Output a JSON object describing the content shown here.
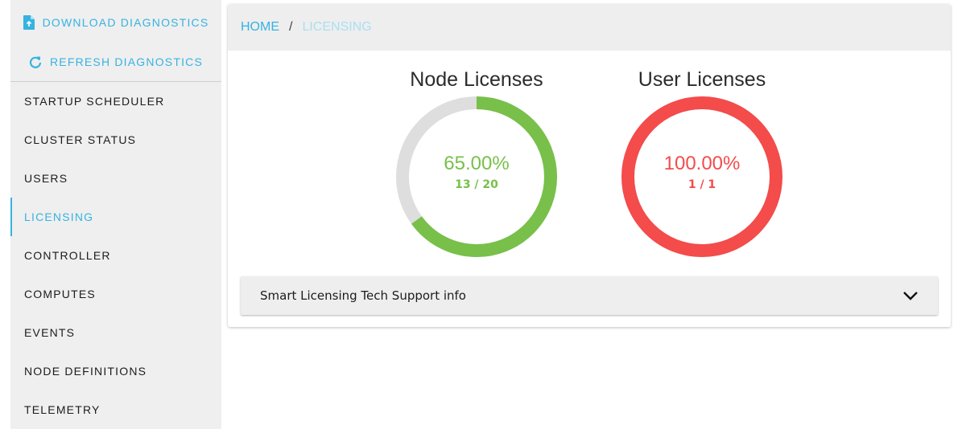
{
  "sidebar": {
    "download_label": "DOWNLOAD DIAGNOSTICS",
    "refresh_label": "REFRESH DIAGNOSTICS",
    "items": [
      {
        "label": "STARTUP SCHEDULER"
      },
      {
        "label": "CLUSTER STATUS"
      },
      {
        "label": "USERS"
      },
      {
        "label": "LICENSING"
      },
      {
        "label": "CONTROLLER"
      },
      {
        "label": "COMPUTES"
      },
      {
        "label": "EVENTS"
      },
      {
        "label": "NODE DEFINITIONS"
      },
      {
        "label": "TELEMETRY"
      }
    ],
    "active_item": "LICENSING"
  },
  "breadcrumb": {
    "home": "HOME",
    "separator": "/",
    "current": "LICENSING"
  },
  "gauges": {
    "node": {
      "title": "Node Licenses",
      "percent_text": "65.00%",
      "count_text": "13 / 20",
      "fraction": 0.65,
      "color": "#78c04a"
    },
    "user": {
      "title": "User Licenses",
      "percent_text": "100.00%",
      "count_text": "1 / 1",
      "fraction": 1.0,
      "color": "#f44b4b"
    }
  },
  "accordion": {
    "label": "Smart Licensing Tech Support info",
    "icon": "chevron-down-icon"
  },
  "colors": {
    "accent": "#36b3e0",
    "track": "#dedede"
  }
}
